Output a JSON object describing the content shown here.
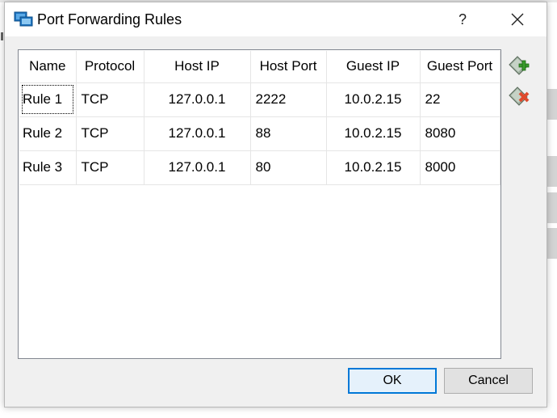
{
  "dialog": {
    "title": "Port Forwarding Rules",
    "help_label": "?",
    "close_label": "✕"
  },
  "table": {
    "columns": [
      "Name",
      "Protocol",
      "Host IP",
      "Host Port",
      "Guest IP",
      "Guest Port"
    ],
    "rows": [
      [
        "Rule 1",
        "TCP",
        "127.0.0.1",
        "2222",
        "10.0.2.15",
        "22"
      ],
      [
        "Rule 2",
        "TCP",
        "127.0.0.1",
        "88",
        "10.0.2.15",
        "8080"
      ],
      [
        "Rule 3",
        "TCP",
        "127.0.0.1",
        "80",
        "10.0.2.15",
        "8000"
      ]
    ]
  },
  "side_buttons": {
    "add_icon": "add-rule-icon",
    "remove_icon": "remove-rule-icon"
  },
  "buttons": {
    "ok_label": "OK",
    "cancel_label": "Cancel"
  },
  "colors": {
    "accent": "#0078d7",
    "add_green": "#3a9b2c",
    "remove_red": "#e0492c"
  }
}
